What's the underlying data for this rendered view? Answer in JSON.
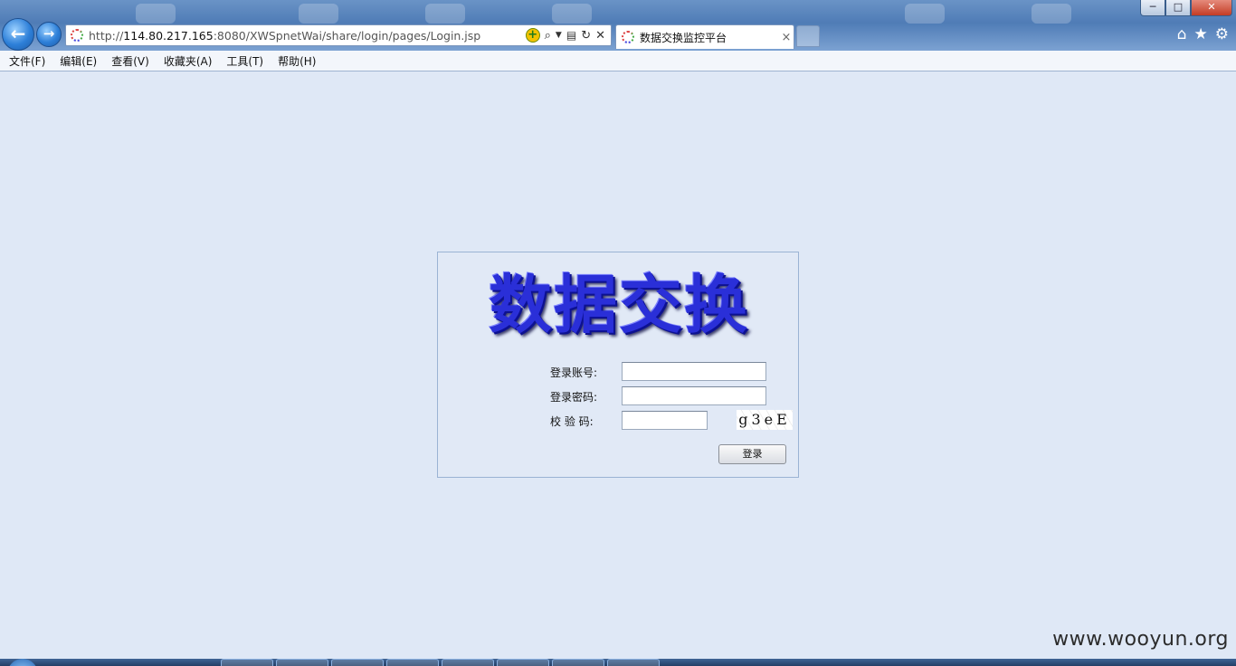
{
  "browser": {
    "address": {
      "prefix": "http://",
      "host": "114.80.217.165",
      "rest": ":8080/XWSpnetWai/share/login/pages/Login.jsp"
    },
    "tab": {
      "title": "数据交换监控平台",
      "close": "×"
    },
    "window_buttons": {
      "minimize": "─",
      "maximize": "□",
      "close": "✕"
    }
  },
  "menu": [
    "文件(F)",
    "编辑(E)",
    "查看(V)",
    "收藏夹(A)",
    "工具(T)",
    "帮助(H)"
  ],
  "login": {
    "logo_text": "数据交换",
    "account_label": "登录账号:",
    "password_label": "登录密码:",
    "captcha_label": "校 验 码:",
    "account_value": "",
    "password_value": "",
    "captcha_value": "",
    "captcha_image_text": "g3eE",
    "submit_label": "登录"
  },
  "watermark": "www.wooyun.org"
}
